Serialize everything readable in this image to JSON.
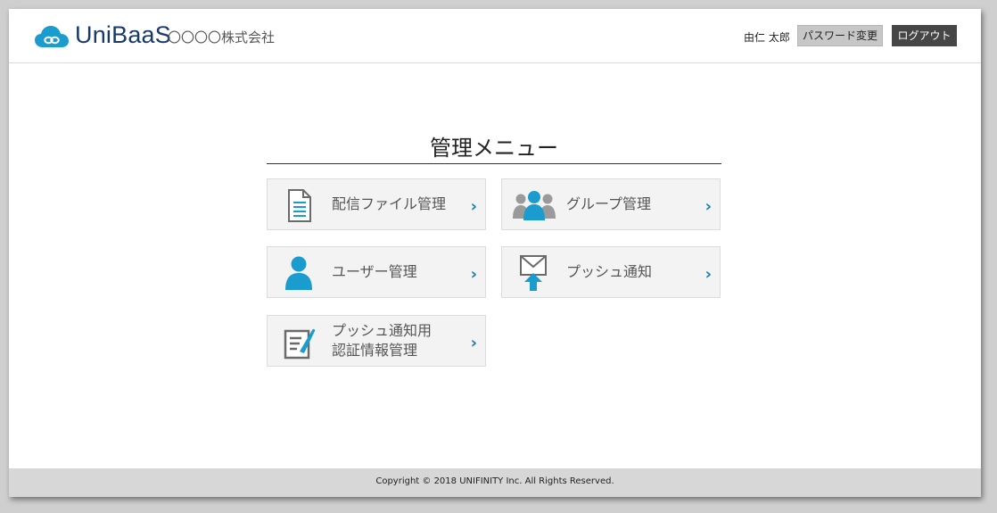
{
  "header": {
    "logo_text": "UniBaaS",
    "company": "〇〇〇〇株式会社",
    "user_name": "由仁 太郎",
    "password_button": "パスワード変更",
    "logout_button": "ログアウト"
  },
  "main": {
    "title": "管理メニュー",
    "menu": [
      {
        "label": "配信ファイル管理",
        "icon": "document-icon"
      },
      {
        "label": "グループ管理",
        "icon": "group-icon"
      },
      {
        "label": "ユーザー管理",
        "icon": "user-icon"
      },
      {
        "label": "プッシュ通知",
        "icon": "mail-push-icon"
      },
      {
        "label_line1": "プッシュ通知用",
        "label_line2": "認証情報管理",
        "icon": "certificate-edit-icon"
      }
    ],
    "chevron": "›"
  },
  "footer": {
    "copyright": "Copyright © 2018 UNIFINITY Inc. All Rights Reserved."
  },
  "colors": {
    "accent": "#1a9ccf",
    "brand_text": "#173a6b",
    "logout_bg": "#464646"
  }
}
